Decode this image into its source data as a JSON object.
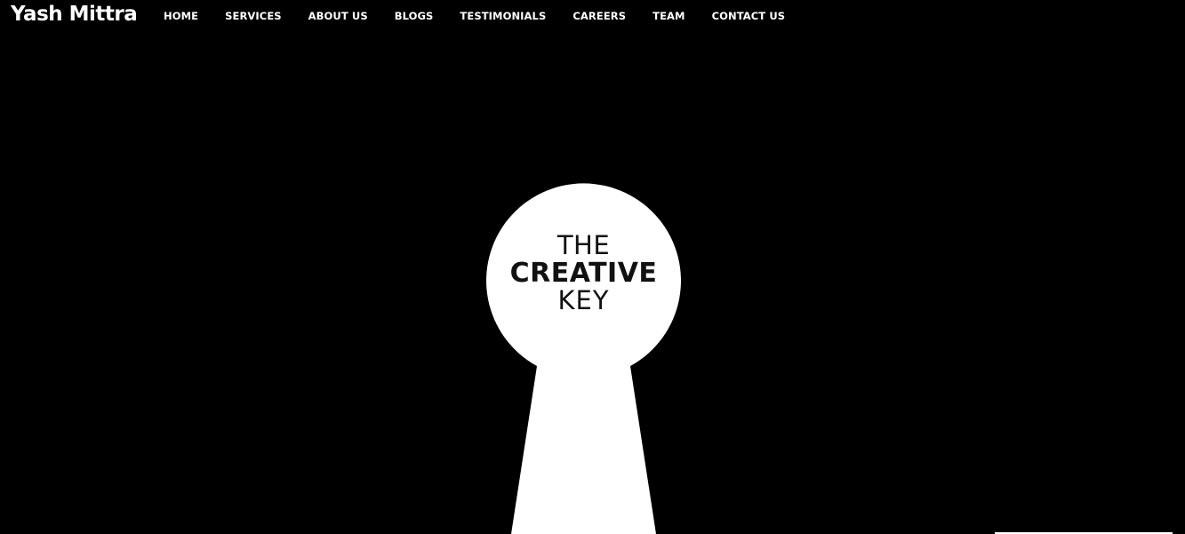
{
  "header": {
    "brand": "Yash Mittra",
    "nav": [
      "HOME",
      "SERVICES",
      "ABOUT US",
      "BLOGS",
      "TESTIMONIALS",
      "CAREERS",
      "TEAM",
      "CONTACT US"
    ]
  },
  "hero": {
    "logo_line1": "THE",
    "logo_line2": "CREATIVE",
    "logo_line3": "KEY"
  },
  "colors": {
    "background": "#000000",
    "text": "#ffffff",
    "keyhole": "#ffffff",
    "logo_text": "#111111"
  }
}
